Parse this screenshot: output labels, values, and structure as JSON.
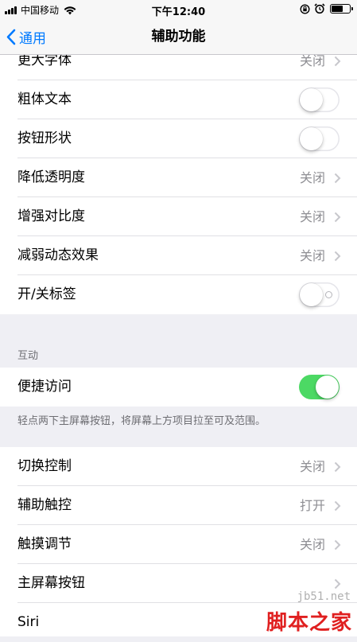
{
  "status_bar": {
    "carrier": "中国移动",
    "time": "下午12:40"
  },
  "nav": {
    "back_label": "通用",
    "title": "辅助功能"
  },
  "group1": {
    "rows": [
      {
        "label": "更大字体",
        "value": "关闭"
      },
      {
        "label": "粗体文本"
      },
      {
        "label": "按钮形状"
      },
      {
        "label": "降低透明度",
        "value": "关闭"
      },
      {
        "label": "增强对比度",
        "value": "关闭"
      },
      {
        "label": "减弱动态效果",
        "value": "关闭"
      },
      {
        "label": "开/关标签"
      }
    ]
  },
  "interaction": {
    "header": "互动",
    "shortcut_label": "便捷访问",
    "shortcut_on": true,
    "footer": "轻点两下主屏幕按钮，将屏幕上方项目拉至可及范围。"
  },
  "group3": {
    "rows": [
      {
        "label": "切换控制",
        "value": "关闭"
      },
      {
        "label": "辅助触控",
        "value": "打开"
      },
      {
        "label": "触摸调节",
        "value": "关闭"
      },
      {
        "label": "主屏幕按钮"
      },
      {
        "label": "Siri"
      }
    ]
  },
  "watermark": {
    "url": "jb51.net",
    "name": "脚本之家"
  },
  "colors": {
    "accent": "#007aff",
    "toggle_on": "#4cd964"
  }
}
